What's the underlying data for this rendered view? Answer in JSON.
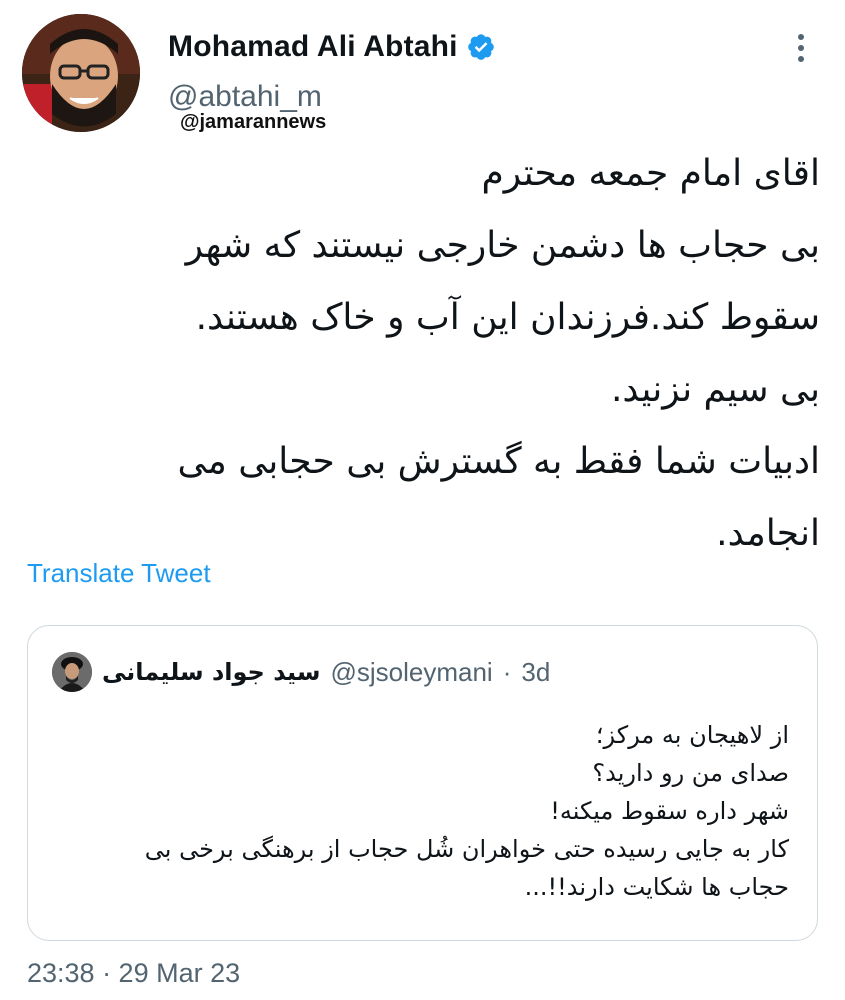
{
  "author": {
    "display_name": "Mohamad Ali Abtahi",
    "handle": "@abtahi_m",
    "verified_icon": "verified-badge-icon",
    "avatar_icon": "profile-photo"
  },
  "watermark": "@jamarannews",
  "tweet": {
    "lines": [
      "اقای امام جمعه محترم",
      "بی حجاب ها دشمن خارجی نیستند که شهر",
      "سقوط کند.فرزندان این آب و خاک هستند.",
      "بی سیم نزنید.",
      "ادبیات شما فقط به گسترش بی حجابی  می",
      "انجامد."
    ],
    "translate_label": "Translate Tweet",
    "timestamp": "23:38 · 29 Mar 23"
  },
  "quoted_tweet": {
    "name": "سید جواد سلیمانی",
    "handle": "@sjsoleymani",
    "separator": "·",
    "time": "3d",
    "lines": [
      "از لاهیجان به مرکز؛",
      "صدای من رو دارید؟",
      "شهر داره سقوط میکنه!",
      "کار به جایی رسیده حتی خواهران شُل حجاب از برهنگی برخی بی",
      "حجاب ها شکایت دارند!!..."
    ]
  },
  "colors": {
    "accent": "#1d9bf0",
    "text": "#0f1419",
    "secondary": "#536471",
    "border": "#cfd9de"
  }
}
